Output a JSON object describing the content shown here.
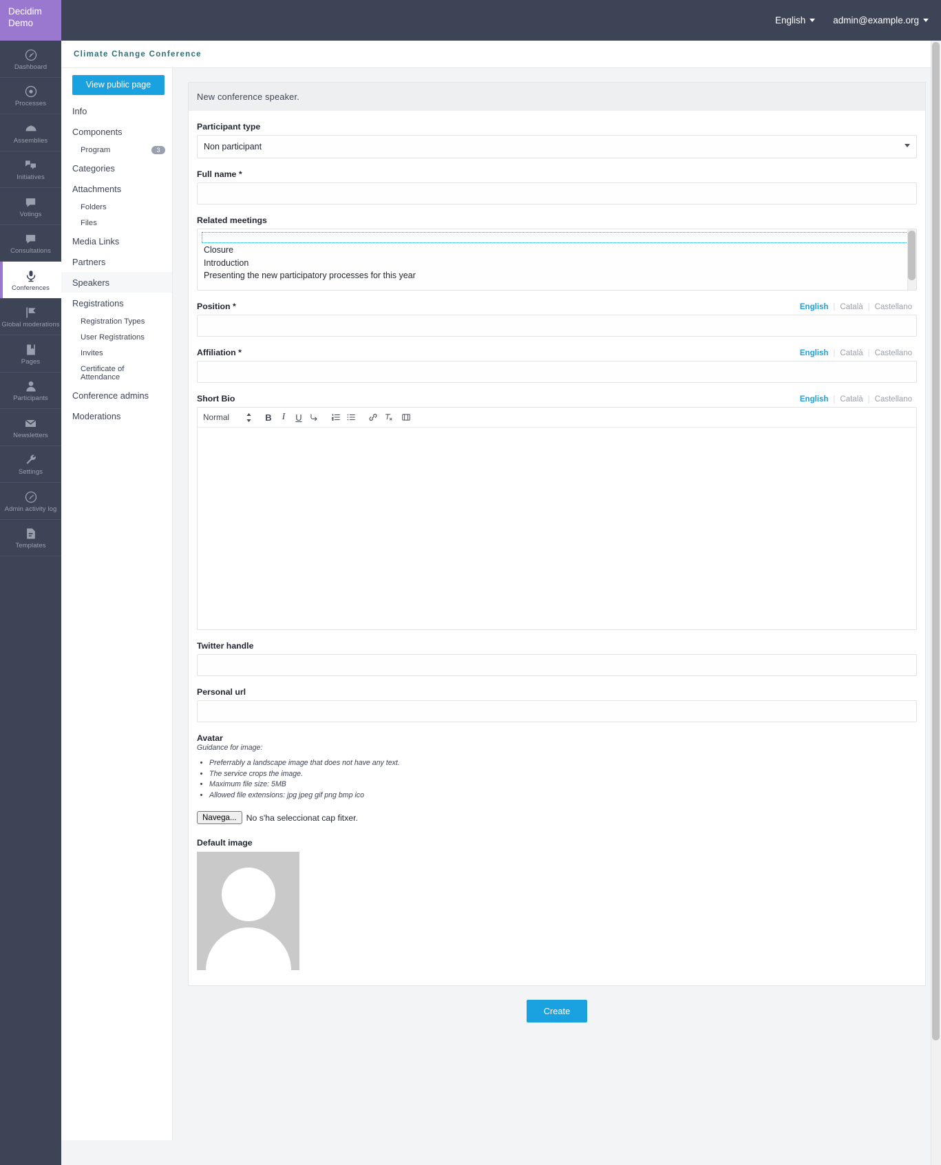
{
  "brand": {
    "line1": "Decidim",
    "line2": "Demo"
  },
  "topbar": {
    "language": "English",
    "account": "admin@example.org"
  },
  "rail": {
    "items": [
      {
        "label": "Dashboard",
        "icon": "dashboard-icon"
      },
      {
        "label": "Processes",
        "icon": "target-icon"
      },
      {
        "label": "Assemblies",
        "icon": "assembly-icon"
      },
      {
        "label": "Initiatives",
        "icon": "initiatives-icon"
      },
      {
        "label": "Votings",
        "icon": "votings-icon"
      },
      {
        "label": "Consultations",
        "icon": "consultations-icon"
      },
      {
        "label": "Conferences",
        "icon": "microphone-icon"
      },
      {
        "label": "Global moderations",
        "icon": "flag-icon"
      },
      {
        "label": "Pages",
        "icon": "book-icon"
      },
      {
        "label": "Participants",
        "icon": "person-icon"
      },
      {
        "label": "Newsletters",
        "icon": "envelope-icon"
      },
      {
        "label": "Settings",
        "icon": "wrench-icon"
      },
      {
        "label": "Admin activity log",
        "icon": "clock-icon"
      },
      {
        "label": "Templates",
        "icon": "templates-icon"
      }
    ]
  },
  "breadcrumb": "Climate Change Conference",
  "secnav": {
    "view_public_page": "View public page",
    "items": [
      {
        "label": "Info",
        "level": 1
      },
      {
        "label": "Components",
        "level": 1
      },
      {
        "label": "Program",
        "level": 2,
        "badge": "3"
      },
      {
        "label": "Categories",
        "level": 1
      },
      {
        "label": "Attachments",
        "level": 1
      },
      {
        "label": "Folders",
        "level": 2
      },
      {
        "label": "Files",
        "level": 2
      },
      {
        "label": "Media Links",
        "level": 1
      },
      {
        "label": "Partners",
        "level": 1
      },
      {
        "label": "Speakers",
        "level": 1,
        "selected": true
      },
      {
        "label": "Registrations",
        "level": 1
      },
      {
        "label": "Registration Types",
        "level": 2
      },
      {
        "label": "User Registrations",
        "level": 2
      },
      {
        "label": "Invites",
        "level": 2
      },
      {
        "label": "Certificate of Attendance",
        "level": 2
      },
      {
        "label": "Conference admins",
        "level": 1
      },
      {
        "label": "Moderations",
        "level": 1
      }
    ]
  },
  "form": {
    "title": "New conference speaker.",
    "participant_type": {
      "label": "Participant type",
      "value": "Non participant",
      "options": [
        "Non participant"
      ]
    },
    "full_name": {
      "label": "Full name",
      "required": "*",
      "value": ""
    },
    "related_meetings": {
      "label": "Related meetings",
      "options": [
        "",
        "Closure",
        "Introduction",
        "Presenting the new participatory processes for this year"
      ]
    },
    "position": {
      "label": "Position",
      "required": "*",
      "value": ""
    },
    "affiliation": {
      "label": "Affiliation",
      "required": "*",
      "value": ""
    },
    "short_bio": {
      "label": "Short Bio",
      "value": ""
    },
    "twitter_handle": {
      "label": "Twitter handle",
      "value": ""
    },
    "personal_url": {
      "label": "Personal url",
      "value": ""
    },
    "languages": [
      "English",
      "Català",
      "Castellano"
    ],
    "active_language": "English",
    "editor": {
      "block_format": "Normal",
      "tools": [
        "bold-icon",
        "italic-icon",
        "underline-icon",
        "erase-icon",
        "ordered-list-icon",
        "bullet-list-icon",
        "link-icon",
        "clear-format-icon",
        "video-icon"
      ]
    },
    "avatar": {
      "label": "Avatar",
      "guidance_title": "Guidance for image:",
      "guidance": [
        "Preferrably a landscape image that does not have any text.",
        "The service crops the image.",
        "Maximum file size: 5MB",
        "Allowed file extensions: jpg jpeg gif png bmp ico"
      ],
      "browse_button": "Navega...",
      "file_status": "No s'ha seleccionat cap fitxer."
    },
    "default_image": {
      "label": "Default image"
    },
    "submit": "Create"
  },
  "colors": {
    "accent": "#1aa2e0",
    "brand_purple": "#9b78cf",
    "rail_bg": "#3c4455",
    "breadcrumb": "#2c6e77"
  }
}
